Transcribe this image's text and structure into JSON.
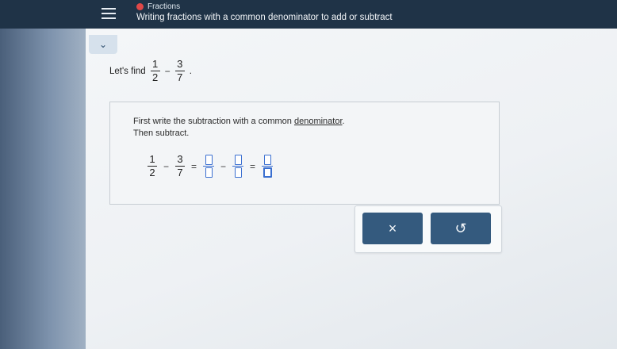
{
  "header": {
    "course": "Fractions",
    "topic": "Writing fractions with a common denominator to add or subtract"
  },
  "prompt": {
    "lead": "Let's find",
    "frac1": {
      "num": "1",
      "den": "2"
    },
    "operator": "−",
    "frac2": {
      "num": "3",
      "den": "7"
    },
    "end": "."
  },
  "instructions": {
    "line1_before": "First write the subtraction with a common ",
    "line1_term": "denominator",
    "line1_after": ".",
    "line2": "Then subtract."
  },
  "equation": {
    "frac1": {
      "num": "1",
      "den": "2"
    },
    "minus1": "−",
    "frac2": {
      "num": "3",
      "den": "7"
    },
    "eq1": "=",
    "minus2": "−",
    "eq2": "="
  },
  "buttons": {
    "clear": "×",
    "undo": "↺"
  },
  "colors": {
    "header": "#1f3347",
    "accent": "#3a6fd0",
    "button": "#345a7e",
    "status_dot": "#e04848"
  }
}
